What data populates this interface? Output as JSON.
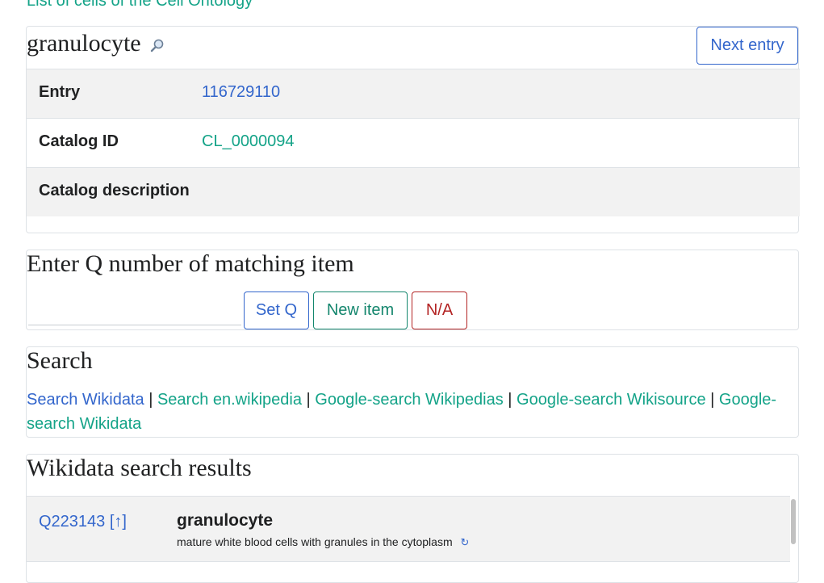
{
  "top_link": "List of cells of the Cell Ontology",
  "entry": {
    "title": "granulocyte",
    "next_button": "Next entry",
    "rows": [
      {
        "label": "Entry",
        "value": "116729110"
      },
      {
        "label": "Catalog ID",
        "value": "CL_0000094"
      },
      {
        "label": "Catalog description",
        "value": ""
      }
    ]
  },
  "q_section": {
    "heading": "Enter Q number of matching item",
    "input_value": "",
    "input_placeholder": "",
    "set_q": "Set Q",
    "new_item": "New item",
    "na": "N/A"
  },
  "search": {
    "heading": "Search",
    "links": [
      "Search Wikidata",
      "Search en.wikipedia",
      "Google-search Wikipedias",
      "Google-search Wikisource",
      "Google-search Wikidata"
    ],
    "separator": "|"
  },
  "results": {
    "heading": "Wikidata search results",
    "items": [
      {
        "q": "Q223143",
        "arrow": "[↑]",
        "label": "granulocyte",
        "description": "mature white blood cells with granules in the cytoplasm",
        "refresh": "↻"
      }
    ]
  },
  "icons": {
    "magnify": "magnify-icon",
    "refresh": "refresh-icon"
  },
  "colors": {
    "link_blue": "#3366cc",
    "link_green": "#14a388",
    "danger": "#b32424",
    "row_shade": "#f2f2f2"
  }
}
